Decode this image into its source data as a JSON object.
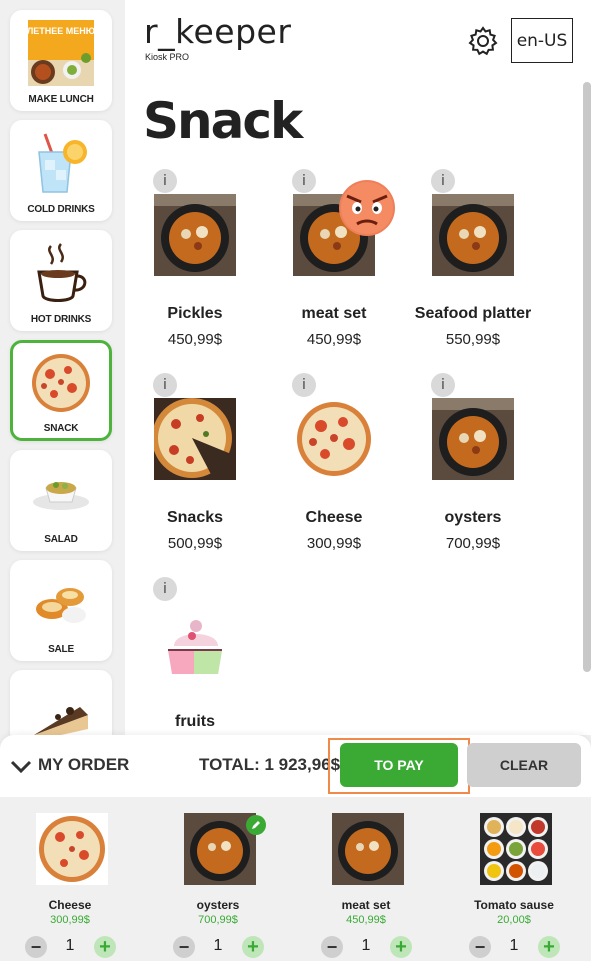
{
  "header": {
    "brand": "r_keeper",
    "brand_sub": "Kiosk PRO",
    "language": "en-US",
    "heading": "Snack"
  },
  "sidebar": {
    "items": [
      {
        "label": "MAKE LUNCH",
        "image": "lunch-menu-image",
        "active": false,
        "promo_text": "ЛЕТНЕЕ МЕНЮ"
      },
      {
        "label": "COLD DRINKS",
        "image": "cold-drink-icon",
        "active": false
      },
      {
        "label": "HOT DRINKS",
        "image": "hot-drink-icon",
        "active": false
      },
      {
        "label": "SNACK",
        "image": "pizza-icon",
        "active": true
      },
      {
        "label": "SALAD",
        "image": "salad-icon",
        "active": false
      },
      {
        "label": "SALE",
        "image": "pastry-icon",
        "active": false
      },
      {
        "label": "",
        "image": "cake-icon",
        "active": false
      }
    ]
  },
  "products": [
    {
      "name": "Pickles",
      "price": "450,99$",
      "image": "soup-image"
    },
    {
      "name": "meat set",
      "price": "450,99$",
      "image": "soup-image"
    },
    {
      "name": "Seafood platter",
      "price": "550,99$",
      "image": "soup-image"
    },
    {
      "name": "Snacks",
      "price": "500,99$",
      "image": "pizza-slice-image"
    },
    {
      "name": "Cheese",
      "price": "300,99$",
      "image": "pizza-image"
    },
    {
      "name": "oysters",
      "price": "700,99$",
      "image": "soup-image"
    },
    {
      "name": "fruits",
      "price": "",
      "image": "cupcake-icon"
    }
  ],
  "info_label": "i",
  "order": {
    "my_order_label": "MY ORDER",
    "total_label": "TOTAL: 1 923,96$",
    "to_pay_label": "TO PAY",
    "clear_label": "CLEAR"
  },
  "cart": [
    {
      "name": "Cheese",
      "price": "300,99$",
      "qty": "1",
      "image": "pizza-image"
    },
    {
      "name": "oysters",
      "price": "700,99$",
      "qty": "1",
      "image": "soup-image",
      "edited": true
    },
    {
      "name": "meat set",
      "price": "450,99$",
      "qty": "1",
      "image": "soup-image"
    },
    {
      "name": "Tomato sause",
      "price": "20,00$",
      "qty": "1",
      "image": "sauces-image"
    }
  ],
  "qty_controls": {
    "minus": "−",
    "plus": "+"
  },
  "colors": {
    "accent": "#3aaa35",
    "highlight": "#f08a4b",
    "active_border": "#4db33d"
  }
}
